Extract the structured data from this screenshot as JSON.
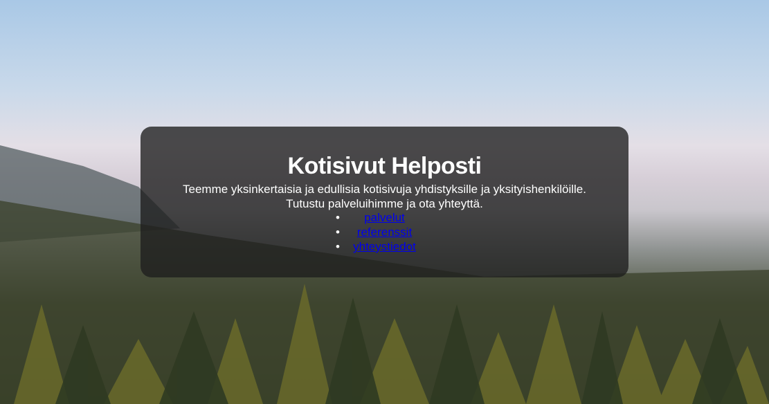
{
  "hero": {
    "title": "Kotisivut Helposti",
    "intro_line1": "Teemme yksinkertaisia ja edullisia kotisivuja yhdistyksille ja yksityishenkilöille.",
    "intro_line2": "Tutustu palveluihimme ja ota yhteyttä."
  },
  "nav": {
    "links": [
      "palvelut",
      "referenssit",
      "yhteystiedot"
    ]
  }
}
